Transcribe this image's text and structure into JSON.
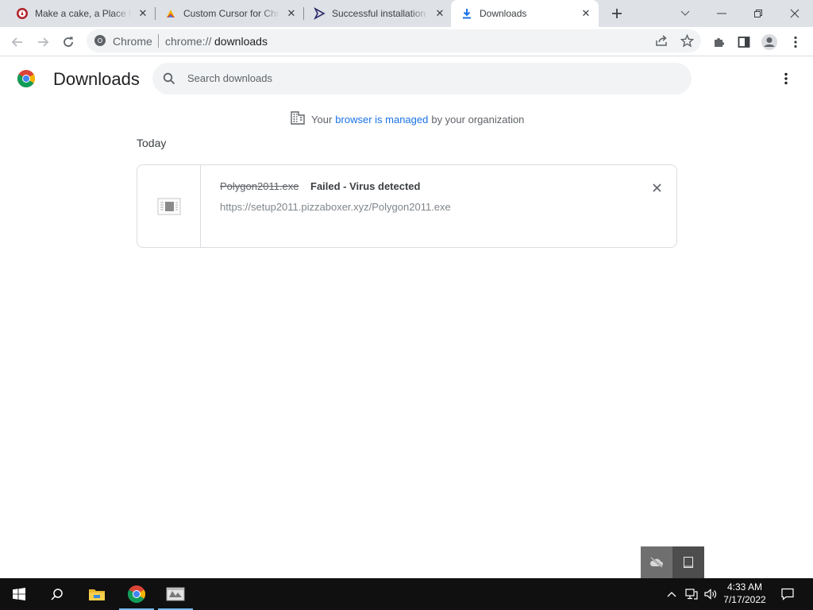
{
  "tabs": [
    {
      "title": "Make a cake, a Place by",
      "icon": "cake-site-favicon"
    },
    {
      "title": "Custom Cursor for Chrome",
      "icon": "custom-cursor-favicon"
    },
    {
      "title": "Successful installation",
      "icon": "cursor-arrow-favicon"
    },
    {
      "title": "Downloads",
      "icon": "download-icon"
    }
  ],
  "address_bar": {
    "site_label": "Chrome",
    "url_prefix": "chrome://",
    "url_path": "downloads"
  },
  "page": {
    "title": "Downloads",
    "search_placeholder": "Search downloads"
  },
  "managed_notice": {
    "prefix": "Your",
    "link": "browser is managed",
    "suffix": "by your organization"
  },
  "sections": [
    {
      "date": "Today",
      "items": [
        {
          "filename": "Polygon2011.exe",
          "status": "Failed - Virus detected",
          "url": "https://setup2011.pizzaboxer.xyz/Polygon2011.exe"
        }
      ]
    }
  ],
  "taskbar": {
    "time": "4:33 AM",
    "date": "7/17/2022"
  },
  "colors": {
    "accent": "#1a73e8",
    "tab_strip": "#dee1e6",
    "taskbar": "#101010"
  }
}
